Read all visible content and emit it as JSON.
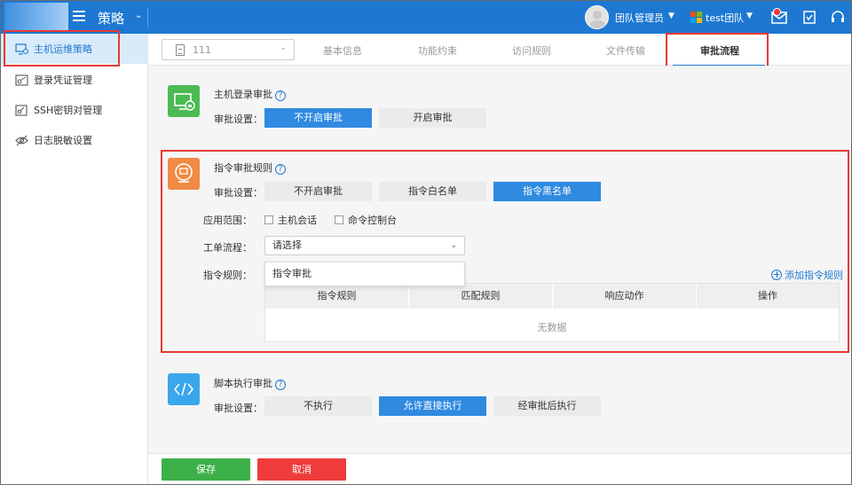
{
  "topbar": {
    "app_title": "策略",
    "user_name": "团队管理员",
    "team_name": "test团队",
    "icons": [
      "menu-icon",
      "user-avatar",
      "team-logo-icon",
      "mail-icon",
      "clipboard-icon",
      "headset-icon"
    ],
    "notification": true
  },
  "colors": {
    "primary": "#1e78d1",
    "accent_button": "#2f8ae0",
    "save_button": "#3db04a",
    "cancel_button": "#ef3b3b",
    "highlight_box": "#e53935",
    "tile_green": "#4cbb54",
    "tile_orange": "#f08a45",
    "tile_blue": "#3aa7ec"
  },
  "sidebar": {
    "items": [
      {
        "label": "主机运维策略",
        "icon": "host-monitor-icon",
        "active": true
      },
      {
        "label": "登录凭证管理",
        "icon": "credential-icon",
        "active": false
      },
      {
        "label": "SSH密钥对管理",
        "icon": "key-icon",
        "active": false
      },
      {
        "label": "日志脱敏设置",
        "icon": "eye-icon",
        "active": false
      }
    ]
  },
  "tabs": {
    "policy_select_value": "111",
    "items": [
      {
        "label": "基本信息",
        "active": false
      },
      {
        "label": "功能约束",
        "active": false
      },
      {
        "label": "访问规则",
        "active": false
      },
      {
        "label": "文件传输",
        "active": false
      },
      {
        "label": "审批流程",
        "active": true
      }
    ]
  },
  "host_login": {
    "title": "主机登录审批",
    "setting_label": "审批设置：",
    "options": [
      {
        "label": "不开启审批",
        "selected": true
      },
      {
        "label": "开启审批",
        "selected": false
      }
    ]
  },
  "command_rule": {
    "title": "指令审批规则",
    "setting_label": "审批设置：",
    "options": [
      {
        "label": "不开启审批",
        "selected": false
      },
      {
        "label": "指令白名单",
        "selected": false
      },
      {
        "label": "指令黑名单",
        "selected": true
      }
    ],
    "scope_label": "应用范围：",
    "scope_options": [
      "主机会话",
      "命令控制台"
    ],
    "workflow_label": "工单流程：",
    "workflow_placeholder": "请选择",
    "dropdown_option": "指令审批",
    "rules_label": "指令规则：",
    "add_rule": "添加指令规则",
    "table_headers": [
      "指令规则",
      "匹配规则",
      "响应动作",
      "操作"
    ],
    "empty_text": "无数据"
  },
  "script_exec": {
    "title": "脚本执行审批",
    "setting_label": "审批设置：",
    "options": [
      {
        "label": "不执行",
        "selected": false
      },
      {
        "label": "允许直接执行",
        "selected": true
      },
      {
        "label": "经审批后执行",
        "selected": false
      }
    ]
  },
  "footer": {
    "save_label": "保存",
    "cancel_label": "取消"
  }
}
